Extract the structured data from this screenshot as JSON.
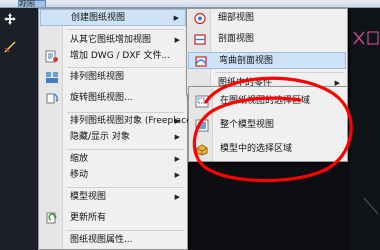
{
  "menubar": {
    "items": [
      "视图"
    ]
  },
  "menu": {
    "items": [
      {
        "label": "创建图纸视图",
        "submenu": true,
        "highlighted": true,
        "icon": ""
      },
      {
        "label": "从其它图纸增加视图",
        "submenu": true,
        "icon": ""
      },
      {
        "label": "增加 DWG / DXF 文件...",
        "submenu": false,
        "icon": "dwg-icon"
      },
      {
        "label": "排列图纸视图",
        "submenu": false,
        "icon": "arrange-views-icon"
      },
      {
        "label": "旋转图纸视图...",
        "submenu": false,
        "icon": "rotate-view-icon"
      },
      {
        "label": "排列图纸视图对象 (Freeplace)",
        "submenu": true,
        "icon": ""
      },
      {
        "label": "隐藏/显示 对象",
        "submenu": true,
        "icon": ""
      },
      {
        "label": "缩放",
        "submenu": true,
        "icon": ""
      },
      {
        "label": "移动",
        "submenu": true,
        "icon": ""
      },
      {
        "label": "模型视图",
        "submenu": true,
        "icon": ""
      },
      {
        "label": "更新所有",
        "submenu": false,
        "icon": "update-all-icon"
      },
      {
        "label": "图纸视图属性...",
        "submenu": false,
        "icon": ""
      }
    ]
  },
  "submenu1": {
    "items": [
      {
        "label": "细部视图",
        "icon": "detail-view-icon"
      },
      {
        "label": "剖面视图",
        "icon": "section-view-icon"
      },
      {
        "label": "弯曲剖面视图",
        "icon": "curved-section-icon",
        "highlighted": true
      },
      {
        "label": "图纸中的零件",
        "submenu": true,
        "icon": ""
      }
    ]
  },
  "submenu2": {
    "items": [
      {
        "label": "在图纸视图的选择区域",
        "icon": "selection-area-icon"
      },
      {
        "label": "整个模型视图",
        "icon": "whole-model-icon"
      },
      {
        "label": "模型中的选择区域",
        "icon": "model-selection-icon"
      }
    ]
  },
  "colors": {
    "annotation": "#ff0000",
    "highlight": "#cfe3f8",
    "menu_bg": "#f0f0f0"
  }
}
